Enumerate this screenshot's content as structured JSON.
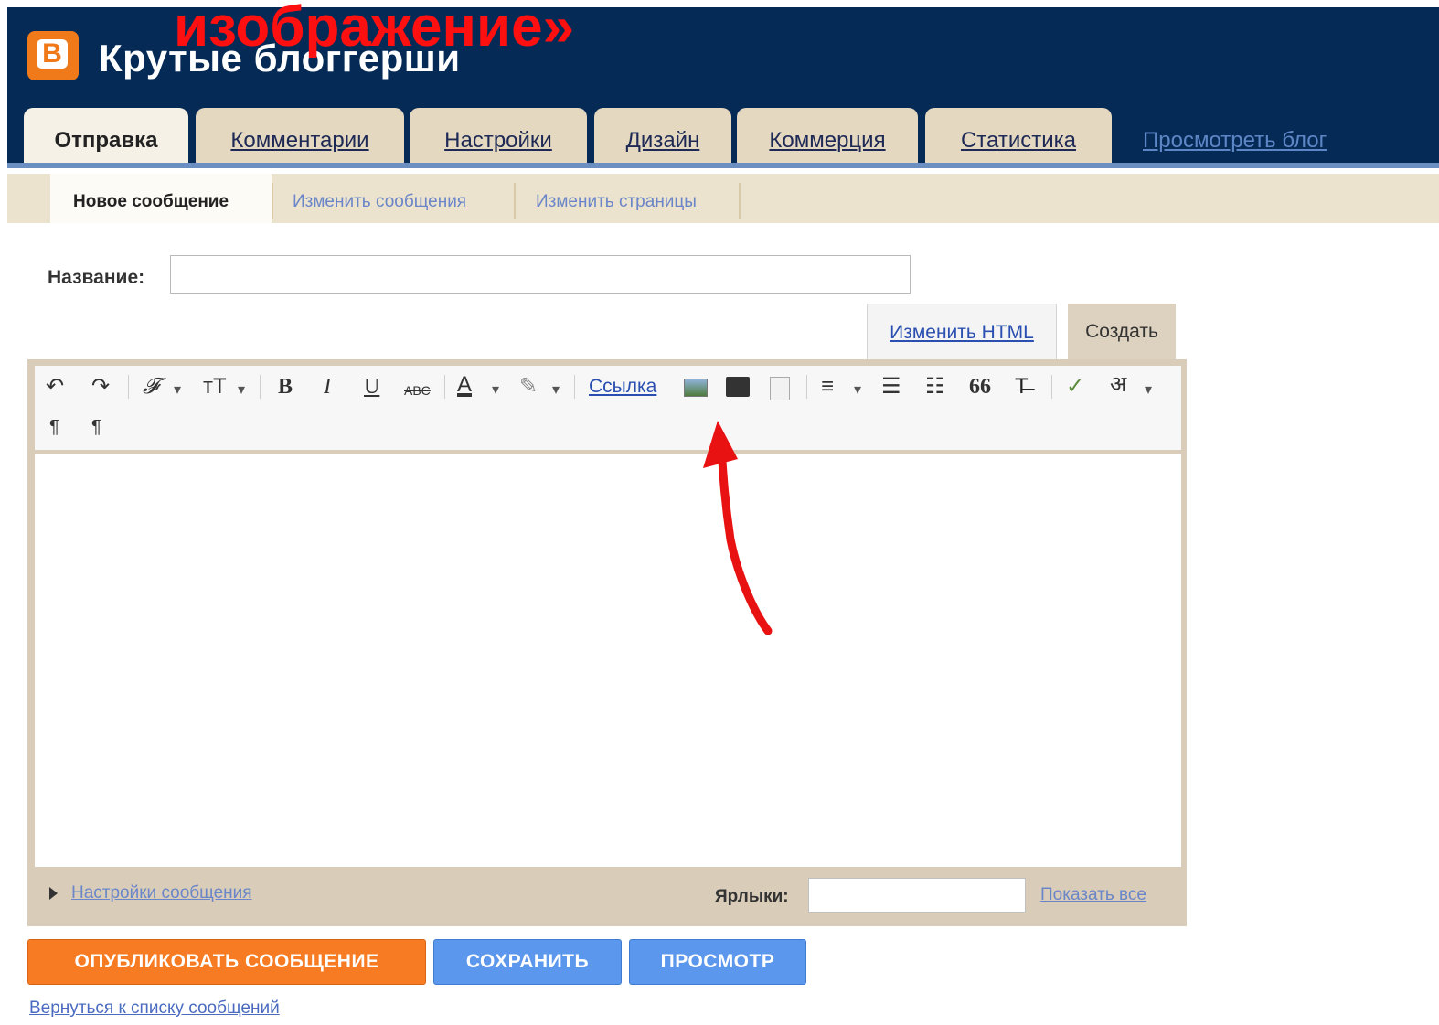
{
  "overlay_caption": "изображение»",
  "blog": {
    "title": "Крутые блоггерши",
    "logo_letter": "B"
  },
  "tabs": [
    {
      "label": "Отправка",
      "active": true
    },
    {
      "label": "Комментарии"
    },
    {
      "label": "Настройки"
    },
    {
      "label": "Дизайн"
    },
    {
      "label": "Коммерция"
    },
    {
      "label": "Статистика"
    }
  ],
  "view_blog": "Просмотреть блог",
  "subnav": [
    {
      "label": "Новое сообщение",
      "active": true
    },
    {
      "label": "Изменить сообщения"
    },
    {
      "label": "Изменить страницы"
    }
  ],
  "title_field": {
    "label": "Название:",
    "value": ""
  },
  "mode_tabs": {
    "html": "Изменить HTML",
    "compose": "Создать"
  },
  "toolbar": {
    "undo": "↶",
    "redo": "↷",
    "font": "𝓕",
    "font_size": "тT",
    "bold": "B",
    "italic": "I",
    "underline": "U",
    "strike": "ABC",
    "text_color": "A",
    "link": "Ссылка",
    "quote": "66",
    "rtl": "¶",
    "ltr": "¶"
  },
  "footer_bar": {
    "settings_link": "Настройки сообщения",
    "labels_label": "Ярлыки:",
    "labels_value": "",
    "show_all": "Показать все"
  },
  "buttons": {
    "publish": "ОПУБЛИКОВАТЬ СООБЩЕНИЕ",
    "save": "СОХРАНИТЬ",
    "preview": "ПРОСМОТР"
  },
  "back_link": "Вернуться к списку сообщений",
  "colors": {
    "header": "#062a56",
    "accent_orange": "#f77b22",
    "accent_blue": "#5b97ec",
    "annotation_red": "#e81212"
  }
}
